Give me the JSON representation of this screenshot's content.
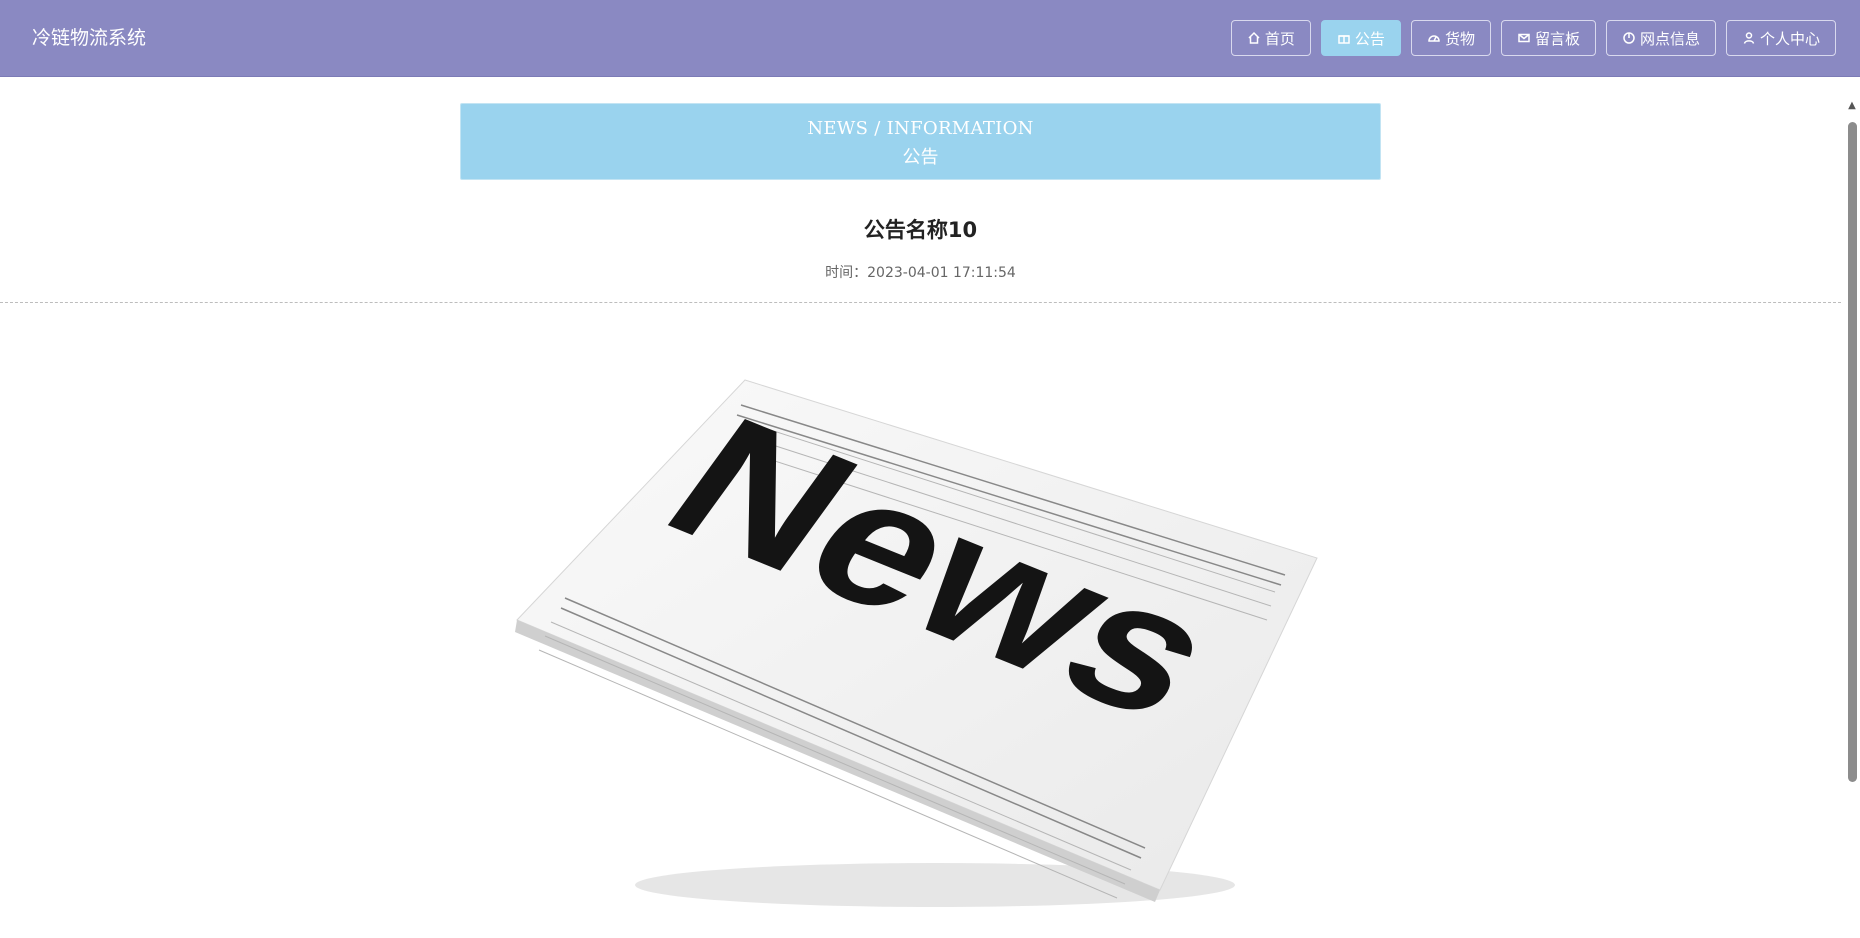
{
  "header": {
    "brand": "冷链物流系统",
    "nav": [
      {
        "label": "首页",
        "icon": "home-icon"
      },
      {
        "label": "公告",
        "icon": "gift-icon",
        "active": true
      },
      {
        "label": "货物",
        "icon": "gauge-icon"
      },
      {
        "label": "留言板",
        "icon": "mail-icon"
      },
      {
        "label": "网点信息",
        "icon": "power-icon"
      },
      {
        "label": "个人中心",
        "icon": "user-icon"
      }
    ]
  },
  "banner": {
    "english": "NEWS / INFORMATION",
    "chinese": "公告"
  },
  "article": {
    "title": "公告名称10",
    "time_label": "时间：",
    "time_value": "2023-04-01 17:11:54",
    "image_word": "News"
  },
  "colors": {
    "header_bg": "#8a89c2",
    "accent": "#9ad3ee"
  }
}
